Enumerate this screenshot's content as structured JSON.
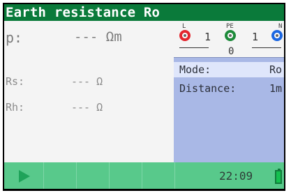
{
  "header": {
    "title": "Earth resistance Ro"
  },
  "left": {
    "rho_label": "p:",
    "rho_value": "--- Ωm",
    "rs_label": "Rs:",
    "rs_value": "--- Ω",
    "rh_label": "Rh:",
    "rh_value": "--- Ω"
  },
  "terminals": {
    "l_label": "L",
    "pe_label": "PE",
    "n_label": "N",
    "l_pe": "1",
    "pe_n": "1",
    "l_n": "0"
  },
  "params": {
    "mode_label": "Mode:",
    "mode_value": "Ro",
    "distance_label": "Distance:",
    "distance_value": "1m"
  },
  "status": {
    "time": "22:09"
  },
  "icons": {
    "start": "play-icon",
    "battery": "battery-icon"
  },
  "colors": {
    "title_bg": "#0a7a3a",
    "bottom_bar": "#58c98b",
    "panel_right": "#a9b8e6",
    "terminal_l": "#e3262e",
    "terminal_pe": "#1d8a3a",
    "terminal_n": "#1c67e2"
  }
}
